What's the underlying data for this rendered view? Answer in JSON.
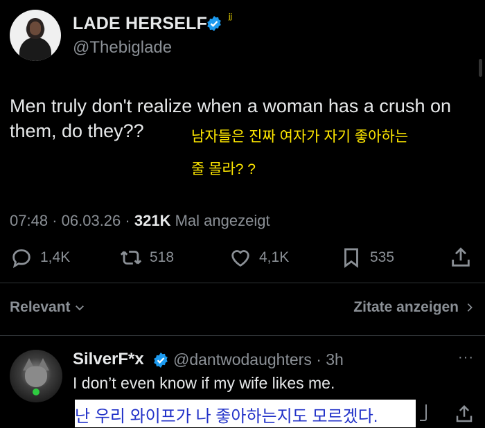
{
  "tweet": {
    "display_name": "LADE HERSELF",
    "handle": "@Thebiglade",
    "annotation": "jj",
    "text": "Men truly don't realize when a woman has a crush on them, do they??",
    "ko_line1": "남자들은 진짜 여자가 자기 좋아하는",
    "ko_line2": "줄 몰라? ?",
    "time": "07:48",
    "date": "06.03.26",
    "sep": "·",
    "views": "321K",
    "views_label": "Mal angezeigt",
    "replies": "1,4K",
    "retweets": "518",
    "likes": "4,1K",
    "bookmarks": "535"
  },
  "filters": {
    "sort_label": "Relevant",
    "quotes_label": "Zitate anzeigen"
  },
  "reply": {
    "display_name": "SilverF*x",
    "handle": "@dantwodaughters",
    "time": "3h",
    "text": "I don’t even know if my wife likes me.",
    "ko_text": "난 우리 와이프가 나 좋아하는지도 모르겠다.",
    "more": "···"
  },
  "colors": {
    "background": "#000000",
    "text": "#e7e9ea",
    "muted": "#8b9096",
    "verified": "#1d9bf0",
    "ko_subtitle": "#ffe800",
    "ko_reply": "#2030c8"
  },
  "icons": [
    "verified-badge-icon",
    "reply-icon",
    "retweet-icon",
    "like-icon",
    "bookmark-icon",
    "share-icon",
    "chevron-down-icon",
    "chevron-right-icon",
    "more-icon"
  ]
}
